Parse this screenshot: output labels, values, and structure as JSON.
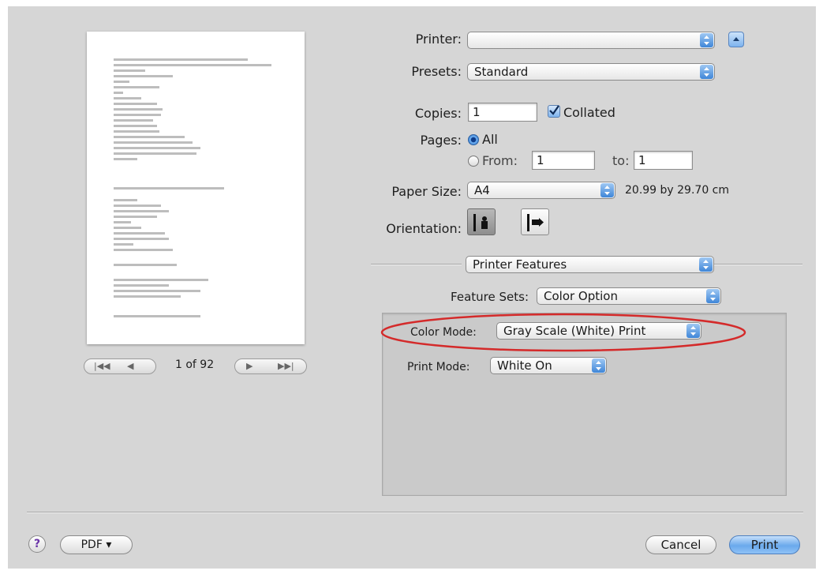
{
  "printer": {
    "label": "Printer:",
    "value": ""
  },
  "presets": {
    "label": "Presets:",
    "value": "Standard"
  },
  "copies": {
    "label": "Copies:",
    "value": "1",
    "collated_label": "Collated",
    "collated_checked": true
  },
  "pages": {
    "label": "Pages:",
    "all_label": "All",
    "from_label": "From:",
    "from_value": "1",
    "to_label": "to:",
    "to_value": "1"
  },
  "paper_size": {
    "label": "Paper Size:",
    "value": "A4",
    "dimensions": "20.99 by 29.70 cm"
  },
  "orientation": {
    "label": "Orientation:"
  },
  "section": {
    "value": "Printer Features"
  },
  "features": {
    "feature_sets_label": "Feature Sets:",
    "feature_sets_value": "Color Option",
    "color_mode_label": "Color Mode:",
    "color_mode_value": "Gray Scale (White) Print",
    "print_mode_label": "Print Mode:",
    "print_mode_value": "White On"
  },
  "preview": {
    "page_indicator": "1 of 92"
  },
  "footer": {
    "help": "?",
    "pdf_label": "PDF ▾",
    "cancel_label": "Cancel",
    "print_label": "Print"
  },
  "colors": {
    "accent": "#3f86d8",
    "highlight_ellipse": "#d42a2a"
  }
}
